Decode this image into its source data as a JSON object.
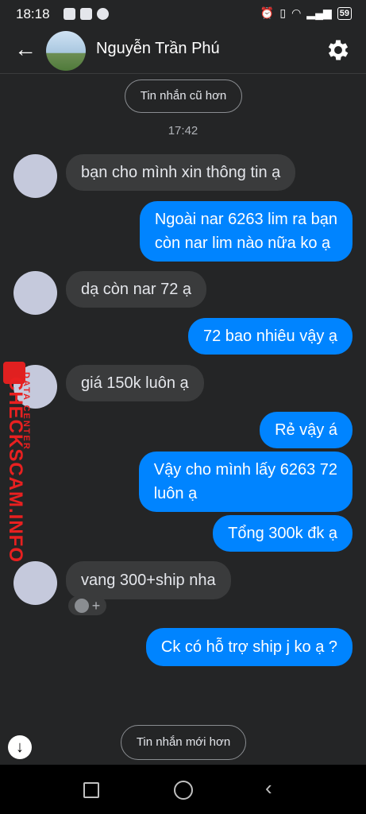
{
  "status_bar": {
    "time": "18:18",
    "battery": "59"
  },
  "header": {
    "contact_name": "Nguyễn Trần Phú"
  },
  "older_messages_label": "Tin nhắn cũ hơn",
  "timestamp": "17:42",
  "messages": [
    {
      "from": "them",
      "text": "bạn cho mình xin thông tin ạ"
    },
    {
      "from": "me",
      "line1": "Ngoài nar 6263 lim ra bạn",
      "line2": "còn nar lim nào nữa ko ạ"
    },
    {
      "from": "them",
      "text": "dạ còn nar 72 ạ"
    },
    {
      "from": "me",
      "text": "72 bao nhiêu vậy ạ"
    },
    {
      "from": "them",
      "text": "giá 150k luôn ạ"
    },
    {
      "from": "me",
      "text": "Rẻ vậy á"
    },
    {
      "from": "me",
      "line1": "Vậy cho mình lấy 6263 72",
      "line2": "luôn ạ"
    },
    {
      "from": "me",
      "text": "Tổng 300k đk ạ"
    },
    {
      "from": "them",
      "text": "vang 300+ship nha"
    },
    {
      "from": "me",
      "text": "Ck có hỗ trợ ship j ko ạ ?"
    }
  ],
  "reaction_add": "+",
  "newer_messages_label": "Tin nhắn mới hơn",
  "watermark": {
    "main": "CHECKSCAM.INFO",
    "sub": "DATA CENTER"
  },
  "colors": {
    "background": "#242526",
    "outgoing_bubble": "#0084ff",
    "incoming_bubble": "#3a3b3c",
    "watermark": "#e82020"
  }
}
